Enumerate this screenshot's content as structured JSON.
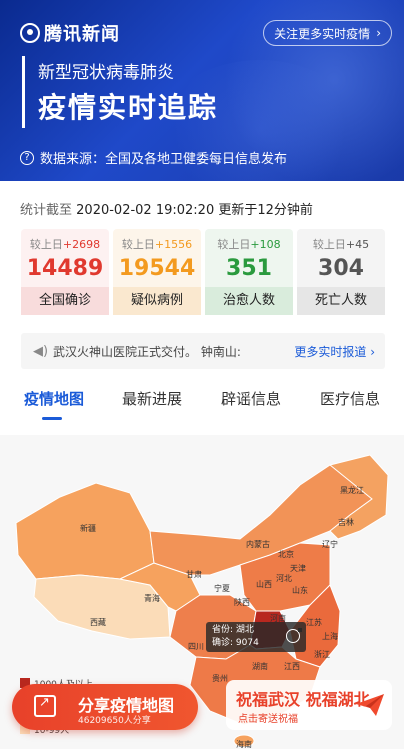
{
  "header": {
    "logo_text": "腾讯新闻",
    "follow_button": "关注更多实时疫情",
    "subtitle": "新型冠状病毒肺炎",
    "title": "疫情实时追踪",
    "source_text": "数据来源：全国及各地卫健委每日信息发布"
  },
  "stats": {
    "time_prefix": "统计截至",
    "time_value": "2020-02-02 19:02:20",
    "update_text": "更新于12分钟前",
    "cards": [
      {
        "delta_label": "较上日",
        "delta": "+2698",
        "value": "14489",
        "label": "全国确诊",
        "color": "#e0392f"
      },
      {
        "delta_label": "较上日",
        "delta": "+1556",
        "value": "19544",
        "label": "疑似病例",
        "color": "#f39a1f"
      },
      {
        "delta_label": "较上日",
        "delta": "+108",
        "value": "351",
        "label": "治愈人数",
        "color": "#2a9a3e"
      },
      {
        "delta_label": "较上日",
        "delta": "+45",
        "value": "304",
        "label": "死亡人数",
        "color": "#555555"
      }
    ]
  },
  "notice": {
    "message": "武汉火神山医院正式交付。  钟南山:",
    "more": "更多实时报道"
  },
  "tabs": [
    "疫情地图",
    "最新进展",
    "辟谣信息",
    "医疗信息"
  ],
  "map": {
    "provinces": [
      "新疆",
      "西藏",
      "青海",
      "甘肃",
      "内蒙古",
      "黑龙江",
      "吉林",
      "辽宁",
      "北京",
      "天津",
      "河北",
      "山西",
      "宁夏",
      "陕西",
      "山东",
      "河南",
      "四川",
      "江苏",
      "上海",
      "浙江",
      "湖南",
      "江西",
      "贵州",
      "海南"
    ],
    "tooltip": {
      "province": "省份: 湖北",
      "confirmed": "确诊: 9074"
    },
    "legend": [
      "1000人及以上",
      "10-99人"
    ]
  },
  "share": {
    "title": "分享疫情地图",
    "count": "46209650人分享"
  },
  "bless": {
    "title": "祝福武汉 祝福湖北",
    "sub": "点击寄送祝福"
  }
}
